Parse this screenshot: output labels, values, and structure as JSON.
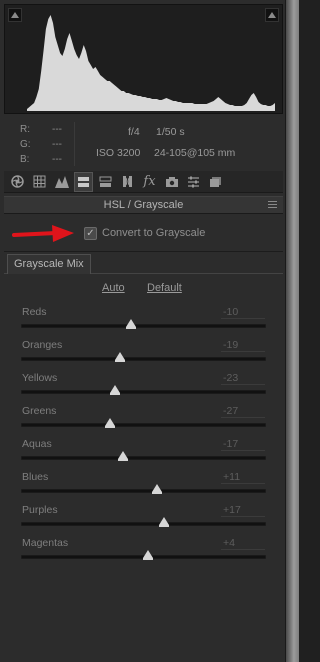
{
  "info": {
    "rgb": [
      {
        "label": "R:",
        "value": "---"
      },
      {
        "label": "G:",
        "value": "---"
      },
      {
        "label": "B:",
        "value": "---"
      }
    ],
    "aperture": "f/4",
    "shutter": "1/50 s",
    "iso": "ISO 3200",
    "lens": "24-105@105 mm"
  },
  "tabs": {
    "items": [
      "basic",
      "tone-curve",
      "detail",
      "hsl-grayscale",
      "split-toning",
      "lens-corrections",
      "effects",
      "camera-calibration",
      "presets",
      "snapshots"
    ],
    "active": "hsl-grayscale"
  },
  "panel": {
    "title": "HSL / Grayscale",
    "convert_label": "Convert to Grayscale",
    "convert_checked": true,
    "check_glyph": "✓"
  },
  "subtab": {
    "label": "Grayscale Mix"
  },
  "links": {
    "auto": "Auto",
    "default": "Default"
  },
  "sliders": [
    {
      "label": "Reds",
      "value": "-10",
      "level": -10
    },
    {
      "label": "Oranges",
      "value": "-19",
      "level": -19
    },
    {
      "label": "Yellows",
      "value": "-23",
      "level": -23
    },
    {
      "label": "Greens",
      "value": "-27",
      "level": -27
    },
    {
      "label": "Aquas",
      "value": "-17",
      "level": -17
    },
    {
      "label": "Blues",
      "value": "+11",
      "level": 11
    },
    {
      "label": "Purples",
      "value": "+17",
      "level": 17
    },
    {
      "label": "Magentas",
      "value": "+4",
      "level": 4
    }
  ],
  "slider_range": [
    -100,
    100
  ],
  "colors": {
    "annotation_arrow": "#e0141b",
    "thumb": "#d6d6d6"
  },
  "histogram": {
    "levels": [
      2,
      4,
      6,
      8,
      14,
      22,
      40,
      60,
      82,
      92,
      96,
      88,
      74,
      66,
      58,
      55,
      62,
      72,
      78,
      70,
      62,
      56,
      52,
      58,
      66,
      60,
      50,
      46,
      42,
      44,
      40,
      36,
      34,
      32,
      30,
      30,
      28,
      26,
      24,
      22,
      20,
      20,
      18,
      18,
      17,
      16,
      16,
      15,
      15,
      14,
      14,
      13,
      13,
      12,
      12,
      12,
      11,
      11,
      12,
      13,
      12,
      11,
      10,
      10,
      9,
      9,
      8,
      8,
      8,
      8,
      8,
      7,
      7,
      7,
      7,
      7,
      7,
      8,
      9,
      10,
      12,
      14,
      12,
      10,
      8,
      7,
      6,
      6,
      5,
      5,
      5,
      5,
      6,
      8,
      12,
      16,
      18,
      14,
      9,
      7,
      6,
      6,
      5,
      5,
      6,
      8
    ]
  }
}
